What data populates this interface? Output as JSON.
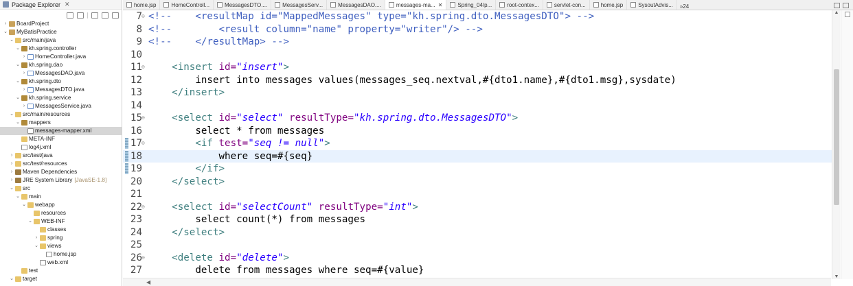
{
  "explorer": {
    "title": "Package Explorer",
    "close_glyph": "✕",
    "items": [
      {
        "label": "BoardProject",
        "icon": "project-icon",
        "twisty": "›",
        "indent": 0
      },
      {
        "label": "MyBatisPractice",
        "icon": "project-icon",
        "twisty": "⌄",
        "indent": 0
      },
      {
        "label": "src/main/java",
        "icon": "folder-icon",
        "twisty": "⌄",
        "indent": 1
      },
      {
        "label": "kh.spring.controller",
        "icon": "package-icon",
        "twisty": "⌄",
        "indent": 2
      },
      {
        "label": "HomeController.java",
        "icon": "java-file-icon",
        "twisty": "›",
        "indent": 3
      },
      {
        "label": "kh.spring.dao",
        "icon": "package-icon",
        "twisty": "⌄",
        "indent": 2
      },
      {
        "label": "MessagesDAO.java",
        "icon": "java-file-icon",
        "twisty": "›",
        "indent": 3
      },
      {
        "label": "kh.spring.dto",
        "icon": "package-icon",
        "twisty": "⌄",
        "indent": 2
      },
      {
        "label": "MessagesDTO.java",
        "icon": "java-file-icon",
        "twisty": "›",
        "indent": 3
      },
      {
        "label": "kh.spring.service",
        "icon": "package-icon",
        "twisty": "⌄",
        "indent": 2
      },
      {
        "label": "MessagesService.java",
        "icon": "java-file-icon",
        "twisty": "›",
        "indent": 3
      },
      {
        "label": "src/main/resources",
        "icon": "folder-icon",
        "twisty": "⌄",
        "indent": 1
      },
      {
        "label": "mappers",
        "icon": "package-icon",
        "twisty": "⌄",
        "indent": 2
      },
      {
        "label": "messages-mapper.xml",
        "icon": "xml-file-icon",
        "twisty": "",
        "indent": 3,
        "selected": true
      },
      {
        "label": "META-INF",
        "icon": "folder-icon",
        "twisty": "",
        "indent": 2
      },
      {
        "label": "log4j.xml",
        "icon": "xml-file-icon",
        "twisty": "",
        "indent": 2
      },
      {
        "label": "src/test/java",
        "icon": "folder-icon",
        "twisty": "›",
        "indent": 1
      },
      {
        "label": "src/test/resources",
        "icon": "folder-icon",
        "twisty": "›",
        "indent": 1
      },
      {
        "label": "Maven Dependencies",
        "icon": "library-icon",
        "twisty": "›",
        "indent": 1
      },
      {
        "label": "JRE System Library",
        "sub": "[JavaSE-1.8]",
        "icon": "library-icon",
        "twisty": "›",
        "indent": 1
      },
      {
        "label": "src",
        "icon": "folder-icon",
        "twisty": "⌄",
        "indent": 1
      },
      {
        "label": "main",
        "icon": "folder-icon",
        "twisty": "⌄",
        "indent": 2
      },
      {
        "label": "webapp",
        "icon": "folder-icon",
        "twisty": "⌄",
        "indent": 3
      },
      {
        "label": "resources",
        "icon": "folder-icon",
        "twisty": "",
        "indent": 4
      },
      {
        "label": "WEB-INF",
        "icon": "folder-icon",
        "twisty": "⌄",
        "indent": 4
      },
      {
        "label": "classes",
        "icon": "folder-icon",
        "twisty": "",
        "indent": 5
      },
      {
        "label": "spring",
        "icon": "folder-icon",
        "twisty": "›",
        "indent": 5
      },
      {
        "label": "views",
        "icon": "folder-icon",
        "twisty": "⌄",
        "indent": 5
      },
      {
        "label": "home.jsp",
        "icon": "jsp-file-icon",
        "twisty": "",
        "indent": 6
      },
      {
        "label": "web.xml",
        "icon": "xml-file-icon",
        "twisty": "",
        "indent": 5
      },
      {
        "label": "test",
        "icon": "folder-icon",
        "twisty": "",
        "indent": 2
      },
      {
        "label": "target",
        "icon": "folder-icon",
        "twisty": "⌄",
        "indent": 1
      }
    ]
  },
  "tabs": [
    {
      "label": "home.jsp"
    },
    {
      "label": "HomeControll..."
    },
    {
      "label": "MessagesDTO...."
    },
    {
      "label": "MessagesServ..."
    },
    {
      "label": "MessagesDAO...."
    },
    {
      "label": "messages-ma...",
      "active": true,
      "close": "✕"
    },
    {
      "label": "Spring_04/p..."
    },
    {
      "label": "root-contex..."
    },
    {
      "label": "servlet-con..."
    },
    {
      "label": "home.jsp"
    },
    {
      "label": "SysoutAdvis..."
    }
  ],
  "tab_overflow": "»24",
  "editor": {
    "current_line": 18,
    "marked_lines": [
      17,
      18,
      19
    ],
    "lines": [
      {
        "n": "7",
        "fold": "⊖",
        "tokens": [
          {
            "t": "comment",
            "v": "<!--    <resultMap id=\"MappedMessages\" type=\"kh.spring.dto.MessagesDTO\"> -->"
          }
        ]
      },
      {
        "n": "8",
        "tokens": [
          {
            "t": "comment",
            "v": "<!--        <result column=\"name\" property=\"writer\"/> -->"
          }
        ]
      },
      {
        "n": "9",
        "tokens": [
          {
            "t": "comment",
            "v": "<!--    </resultMap> -->"
          }
        ]
      },
      {
        "n": "10",
        "tokens": []
      },
      {
        "n": "11",
        "fold": "⊖",
        "tokens": [
          {
            "t": "text",
            "v": "    "
          },
          {
            "t": "tag",
            "v": "<insert "
          },
          {
            "t": "attr",
            "v": "id="
          },
          {
            "t": "val",
            "v": "\"insert\""
          },
          {
            "t": "tag",
            "v": ">"
          }
        ]
      },
      {
        "n": "12",
        "tokens": [
          {
            "t": "text",
            "v": "        insert into messages values(messages_seq.nextval,#{dto1.name},#{dto1.msg},sysdate)"
          }
        ]
      },
      {
        "n": "13",
        "tokens": [
          {
            "t": "text",
            "v": "    "
          },
          {
            "t": "tag",
            "v": "</insert>"
          }
        ]
      },
      {
        "n": "14",
        "tokens": []
      },
      {
        "n": "15",
        "fold": "⊖",
        "tokens": [
          {
            "t": "text",
            "v": "    "
          },
          {
            "t": "tag",
            "v": "<select "
          },
          {
            "t": "attr",
            "v": "id="
          },
          {
            "t": "val",
            "v": "\"select\""
          },
          {
            "t": "text",
            "v": " "
          },
          {
            "t": "attr",
            "v": "resultType="
          },
          {
            "t": "val",
            "v": "\"kh.spring.dto.MessagesDTO\""
          },
          {
            "t": "tag",
            "v": ">"
          }
        ]
      },
      {
        "n": "16",
        "tokens": [
          {
            "t": "text",
            "v": "        select * from messages"
          }
        ]
      },
      {
        "n": "17",
        "fold": "⊖",
        "tokens": [
          {
            "t": "text",
            "v": "        "
          },
          {
            "t": "tag",
            "v": "<if "
          },
          {
            "t": "attr",
            "v": "test="
          },
          {
            "t": "val",
            "v": "\"seq != null\""
          },
          {
            "t": "tag",
            "v": ">"
          }
        ]
      },
      {
        "n": "18",
        "tokens": [
          {
            "t": "text",
            "v": "            where seq=#{seq}"
          }
        ]
      },
      {
        "n": "19",
        "tokens": [
          {
            "t": "text",
            "v": "        "
          },
          {
            "t": "tag",
            "v": "</if>"
          }
        ]
      },
      {
        "n": "20",
        "tokens": [
          {
            "t": "text",
            "v": "    "
          },
          {
            "t": "tag",
            "v": "</select>"
          }
        ]
      },
      {
        "n": "21",
        "tokens": []
      },
      {
        "n": "22",
        "fold": "⊖",
        "tokens": [
          {
            "t": "text",
            "v": "    "
          },
          {
            "t": "tag",
            "v": "<select "
          },
          {
            "t": "attr",
            "v": "id="
          },
          {
            "t": "val",
            "v": "\"selectCount\""
          },
          {
            "t": "text",
            "v": " "
          },
          {
            "t": "attr",
            "v": "resultType="
          },
          {
            "t": "val",
            "v": "\"int\""
          },
          {
            "t": "tag",
            "v": ">"
          }
        ]
      },
      {
        "n": "23",
        "tokens": [
          {
            "t": "text",
            "v": "        select count(*) from messages"
          }
        ]
      },
      {
        "n": "24",
        "tokens": [
          {
            "t": "text",
            "v": "    "
          },
          {
            "t": "tag",
            "v": "</select>"
          }
        ]
      },
      {
        "n": "25",
        "tokens": []
      },
      {
        "n": "26",
        "fold": "⊖",
        "tokens": [
          {
            "t": "text",
            "v": "    "
          },
          {
            "t": "tag",
            "v": "<delete "
          },
          {
            "t": "attr",
            "v": "id="
          },
          {
            "t": "val",
            "v": "\"delete\""
          },
          {
            "t": "tag",
            "v": ">"
          }
        ]
      },
      {
        "n": "27",
        "tokens": [
          {
            "t": "text",
            "v": "        delete from messages where seq=#{value}"
          }
        ]
      }
    ]
  },
  "scrollbar": {
    "up_glyph": "▲",
    "down_glyph": "▼",
    "left_glyph": "◀",
    "thumb_start_fraction": 0.2,
    "thumb_size_fraction": 0.54
  }
}
